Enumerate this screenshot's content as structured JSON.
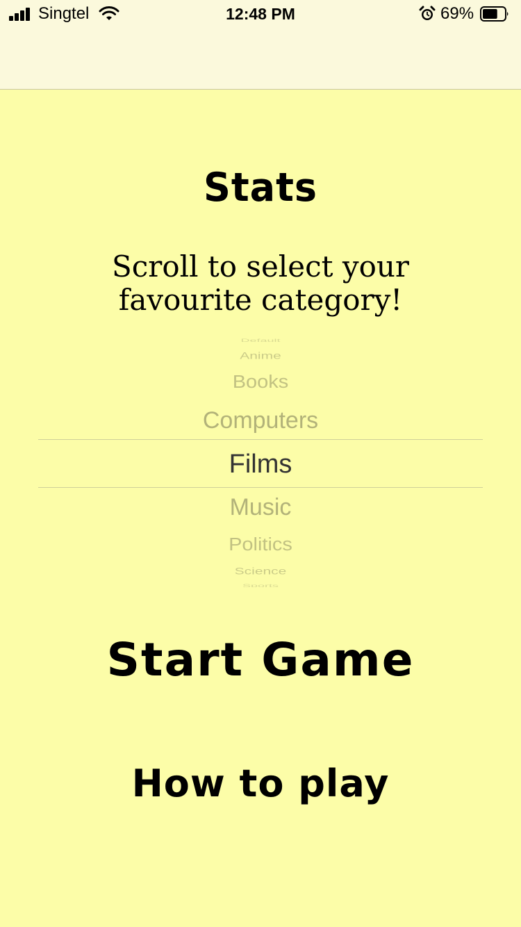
{
  "status_bar": {
    "carrier": "Singtel",
    "time": "12:48 PM",
    "battery_percent": "69%",
    "signal_icon": "cellular-signal-icon",
    "wifi_icon": "wifi-icon",
    "alarm_icon": "alarm-clock-icon",
    "battery_icon": "battery-icon",
    "battery_level": 0.69
  },
  "main": {
    "title": "Stats",
    "subtitle": "Scroll to select your favourite category!",
    "start_label": "Start Game",
    "howto_label": "How to play"
  },
  "picker": {
    "selected": "Films",
    "items": [
      "Default",
      "Anime",
      "Books",
      "Computers",
      "Films",
      "Music",
      "Politics",
      "Science",
      "Sports"
    ]
  },
  "colors": {
    "background": "#fcfda8",
    "header_background": "#fbf9dc",
    "picker_selected_text": "#333333",
    "picker_unselected_text": "#9a9a6a"
  }
}
